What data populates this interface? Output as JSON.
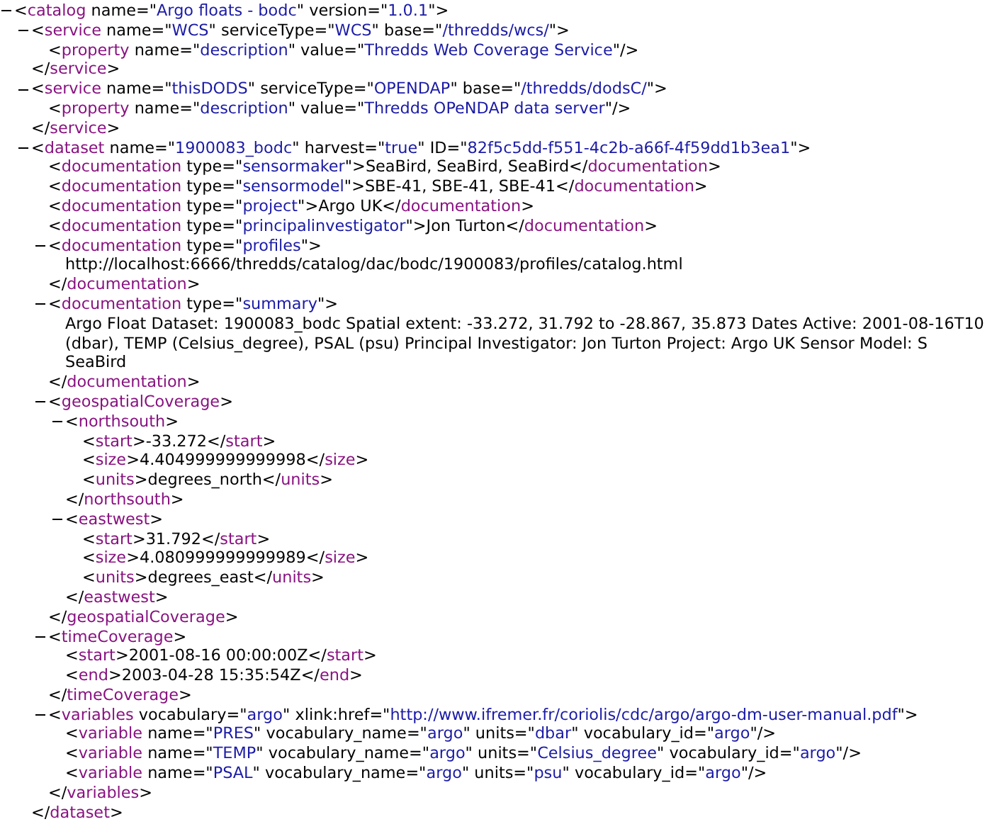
{
  "document": {
    "kind": "element",
    "expanded": true,
    "open": [
      {
        "kind": "punct",
        "text": "<"
      },
      {
        "kind": "tag",
        "text": "catalog"
      },
      {
        "kind": "attr",
        "text": "name"
      },
      {
        "kind": "punct",
        "text": "=\""
      },
      {
        "kind": "value",
        "text": "Argo floats - bodc"
      },
      {
        "kind": "punct",
        "text": "\""
      },
      {
        "kind": "attr",
        "text": "version"
      },
      {
        "kind": "punct",
        "text": "=\""
      },
      {
        "kind": "value",
        "text": "1.0.1"
      },
      {
        "kind": "punct",
        "text": "\">"
      }
    ],
    "children": [
      {
        "kind": "element",
        "expanded": true,
        "open": [
          {
            "kind": "punct",
            "text": "<"
          },
          {
            "kind": "tag",
            "text": "service"
          },
          {
            "kind": "attr",
            "text": "name"
          },
          {
            "kind": "punct",
            "text": "=\""
          },
          {
            "kind": "value",
            "text": "WCS"
          },
          {
            "kind": "punct",
            "text": "\""
          },
          {
            "kind": "attr",
            "text": "serviceType"
          },
          {
            "kind": "punct",
            "text": "=\""
          },
          {
            "kind": "value",
            "text": "WCS"
          },
          {
            "kind": "punct",
            "text": "\""
          },
          {
            "kind": "attr",
            "text": "base"
          },
          {
            "kind": "punct",
            "text": "=\""
          },
          {
            "kind": "value",
            "text": "/thredds/wcs/"
          },
          {
            "kind": "punct",
            "text": "\">"
          }
        ],
        "children": [
          {
            "kind": "line",
            "parts": [
              {
                "kind": "punct",
                "text": "<"
              },
              {
                "kind": "tag",
                "text": "property"
              },
              {
                "kind": "attr",
                "text": "name"
              },
              {
                "kind": "punct",
                "text": "=\""
              },
              {
                "kind": "value",
                "text": "description"
              },
              {
                "kind": "punct",
                "text": "\""
              },
              {
                "kind": "attr",
                "text": "value"
              },
              {
                "kind": "punct",
                "text": "=\""
              },
              {
                "kind": "value",
                "text": "Thredds Web Coverage Service"
              },
              {
                "kind": "punct",
                "text": "\"/>"
              }
            ]
          }
        ],
        "close": [
          {
            "kind": "punct",
            "text": "</"
          },
          {
            "kind": "tag",
            "text": "service"
          },
          {
            "kind": "punct",
            "text": ">"
          }
        ]
      },
      {
        "kind": "element",
        "expanded": true,
        "open": [
          {
            "kind": "punct",
            "text": "<"
          },
          {
            "kind": "tag",
            "text": "service"
          },
          {
            "kind": "attr",
            "text": "name"
          },
          {
            "kind": "punct",
            "text": "=\""
          },
          {
            "kind": "value",
            "text": "thisDODS"
          },
          {
            "kind": "punct",
            "text": "\""
          },
          {
            "kind": "attr",
            "text": "serviceType"
          },
          {
            "kind": "punct",
            "text": "=\""
          },
          {
            "kind": "value",
            "text": "OPENDAP"
          },
          {
            "kind": "punct",
            "text": "\""
          },
          {
            "kind": "attr",
            "text": "base"
          },
          {
            "kind": "punct",
            "text": "=\""
          },
          {
            "kind": "value",
            "text": "/thredds/dodsC/"
          },
          {
            "kind": "punct",
            "text": "\">"
          }
        ],
        "children": [
          {
            "kind": "line",
            "parts": [
              {
                "kind": "punct",
                "text": "<"
              },
              {
                "kind": "tag",
                "text": "property"
              },
              {
                "kind": "attr",
                "text": "name"
              },
              {
                "kind": "punct",
                "text": "=\""
              },
              {
                "kind": "value",
                "text": "description"
              },
              {
                "kind": "punct",
                "text": "\""
              },
              {
                "kind": "attr",
                "text": "value"
              },
              {
                "kind": "punct",
                "text": "=\""
              },
              {
                "kind": "value",
                "text": "Thredds OPeNDAP data server"
              },
              {
                "kind": "punct",
                "text": "\"/>"
              }
            ]
          }
        ],
        "close": [
          {
            "kind": "punct",
            "text": "</"
          },
          {
            "kind": "tag",
            "text": "service"
          },
          {
            "kind": "punct",
            "text": ">"
          }
        ]
      },
      {
        "kind": "element",
        "expanded": true,
        "open": [
          {
            "kind": "punct",
            "text": "<"
          },
          {
            "kind": "tag",
            "text": "dataset"
          },
          {
            "kind": "attr",
            "text": "name"
          },
          {
            "kind": "punct",
            "text": "=\""
          },
          {
            "kind": "value",
            "text": "1900083_bodc"
          },
          {
            "kind": "punct",
            "text": "\""
          },
          {
            "kind": "attr",
            "text": "harvest"
          },
          {
            "kind": "punct",
            "text": "=\""
          },
          {
            "kind": "value",
            "text": "true"
          },
          {
            "kind": "punct",
            "text": "\""
          },
          {
            "kind": "attr",
            "text": "ID"
          },
          {
            "kind": "punct",
            "text": "=\""
          },
          {
            "kind": "value",
            "text": "82f5c5dd-f551-4c2b-a66f-4f59dd1b3ea1"
          },
          {
            "kind": "punct",
            "text": "\">"
          }
        ],
        "children": [
          {
            "kind": "line",
            "parts": [
              {
                "kind": "punct",
                "text": "<"
              },
              {
                "kind": "tag",
                "text": "documentation"
              },
              {
                "kind": "attr",
                "text": "type"
              },
              {
                "kind": "punct",
                "text": "=\""
              },
              {
                "kind": "value",
                "text": "sensormaker"
              },
              {
                "kind": "punct",
                "text": "\">"
              },
              {
                "kind": "text",
                "text": "SeaBird, SeaBird, SeaBird"
              },
              {
                "kind": "punct",
                "text": "</"
              },
              {
                "kind": "tag",
                "text": "documentation"
              },
              {
                "kind": "punct",
                "text": ">"
              }
            ]
          },
          {
            "kind": "line",
            "parts": [
              {
                "kind": "punct",
                "text": "<"
              },
              {
                "kind": "tag",
                "text": "documentation"
              },
              {
                "kind": "attr",
                "text": "type"
              },
              {
                "kind": "punct",
                "text": "=\""
              },
              {
                "kind": "value",
                "text": "sensormodel"
              },
              {
                "kind": "punct",
                "text": "\">"
              },
              {
                "kind": "text",
                "text": "SBE-41, SBE-41, SBE-41"
              },
              {
                "kind": "punct",
                "text": "</"
              },
              {
                "kind": "tag",
                "text": "documentation"
              },
              {
                "kind": "punct",
                "text": ">"
              }
            ]
          },
          {
            "kind": "line",
            "parts": [
              {
                "kind": "punct",
                "text": "<"
              },
              {
                "kind": "tag",
                "text": "documentation"
              },
              {
                "kind": "attr",
                "text": "type"
              },
              {
                "kind": "punct",
                "text": "=\""
              },
              {
                "kind": "value",
                "text": "project"
              },
              {
                "kind": "punct",
                "text": "\">"
              },
              {
                "kind": "text",
                "text": "Argo UK"
              },
              {
                "kind": "punct",
                "text": "</"
              },
              {
                "kind": "tag",
                "text": "documentation"
              },
              {
                "kind": "punct",
                "text": ">"
              }
            ]
          },
          {
            "kind": "line",
            "parts": [
              {
                "kind": "punct",
                "text": "<"
              },
              {
                "kind": "tag",
                "text": "documentation"
              },
              {
                "kind": "attr",
                "text": "type"
              },
              {
                "kind": "punct",
                "text": "=\""
              },
              {
                "kind": "value",
                "text": "principalinvestigator"
              },
              {
                "kind": "punct",
                "text": "\">"
              },
              {
                "kind": "text",
                "text": "Jon Turton"
              },
              {
                "kind": "punct",
                "text": "</"
              },
              {
                "kind": "tag",
                "text": "documentation"
              },
              {
                "kind": "punct",
                "text": ">"
              }
            ]
          },
          {
            "kind": "element",
            "expanded": true,
            "open": [
              {
                "kind": "punct",
                "text": "<"
              },
              {
                "kind": "tag",
                "text": "documentation"
              },
              {
                "kind": "attr",
                "text": "type"
              },
              {
                "kind": "punct",
                "text": "=\""
              },
              {
                "kind": "value",
                "text": "profiles"
              },
              {
                "kind": "punct",
                "text": "\">"
              }
            ],
            "children": [
              {
                "kind": "line",
                "parts": [
                  {
                    "kind": "text",
                    "text": "http://localhost:6666/thredds/catalog/dac/bodc/1900083/profiles/catalog.html"
                  }
                ]
              }
            ],
            "close": [
              {
                "kind": "punct",
                "text": "</"
              },
              {
                "kind": "tag",
                "text": "documentation"
              },
              {
                "kind": "punct",
                "text": ">"
              }
            ]
          },
          {
            "kind": "element",
            "expanded": true,
            "open": [
              {
                "kind": "punct",
                "text": "<"
              },
              {
                "kind": "tag",
                "text": "documentation"
              },
              {
                "kind": "attr",
                "text": "type"
              },
              {
                "kind": "punct",
                "text": "=\""
              },
              {
                "kind": "value",
                "text": "summary"
              },
              {
                "kind": "punct",
                "text": "\">"
              }
            ],
            "children": [
              {
                "kind": "line",
                "parts": [
                  {
                    "kind": "text",
                    "text": "Argo Float Dataset: 1900083_bodc Spatial extent: -33.272, 31.792 to -28.867, 35.873 Dates Active: 2001-08-16T10"
                  }
                ]
              },
              {
                "kind": "line",
                "parts": [
                  {
                    "kind": "text",
                    "text": "(dbar), TEMP (Celsius_degree), PSAL (psu) Principal Investigator: Jon Turton Project: Argo UK Sensor Model: S"
                  }
                ]
              },
              {
                "kind": "line",
                "parts": [
                  {
                    "kind": "text",
                    "text": "SeaBird"
                  }
                ]
              }
            ],
            "close": [
              {
                "kind": "punct",
                "text": "</"
              },
              {
                "kind": "tag",
                "text": "documentation"
              },
              {
                "kind": "punct",
                "text": ">"
              }
            ]
          },
          {
            "kind": "element",
            "expanded": true,
            "open": [
              {
                "kind": "punct",
                "text": "<"
              },
              {
                "kind": "tag",
                "text": "geospatialCoverage"
              },
              {
                "kind": "punct",
                "text": ">"
              }
            ],
            "children": [
              {
                "kind": "element",
                "expanded": true,
                "open": [
                  {
                    "kind": "punct",
                    "text": "<"
                  },
                  {
                    "kind": "tag",
                    "text": "northsouth"
                  },
                  {
                    "kind": "punct",
                    "text": ">"
                  }
                ],
                "children": [
                  {
                    "kind": "line",
                    "parts": [
                      {
                        "kind": "punct",
                        "text": "<"
                      },
                      {
                        "kind": "tag",
                        "text": "start"
                      },
                      {
                        "kind": "punct",
                        "text": ">"
                      },
                      {
                        "kind": "text",
                        "text": "-33.272"
                      },
                      {
                        "kind": "punct",
                        "text": "</"
                      },
                      {
                        "kind": "tag",
                        "text": "start"
                      },
                      {
                        "kind": "punct",
                        "text": ">"
                      }
                    ]
                  },
                  {
                    "kind": "line",
                    "parts": [
                      {
                        "kind": "punct",
                        "text": "<"
                      },
                      {
                        "kind": "tag",
                        "text": "size"
                      },
                      {
                        "kind": "punct",
                        "text": ">"
                      },
                      {
                        "kind": "text",
                        "text": "4.404999999999998"
                      },
                      {
                        "kind": "punct",
                        "text": "</"
                      },
                      {
                        "kind": "tag",
                        "text": "size"
                      },
                      {
                        "kind": "punct",
                        "text": ">"
                      }
                    ]
                  },
                  {
                    "kind": "line",
                    "parts": [
                      {
                        "kind": "punct",
                        "text": "<"
                      },
                      {
                        "kind": "tag",
                        "text": "units"
                      },
                      {
                        "kind": "punct",
                        "text": ">"
                      },
                      {
                        "kind": "text",
                        "text": "degrees_north"
                      },
                      {
                        "kind": "punct",
                        "text": "</"
                      },
                      {
                        "kind": "tag",
                        "text": "units"
                      },
                      {
                        "kind": "punct",
                        "text": ">"
                      }
                    ]
                  }
                ],
                "close": [
                  {
                    "kind": "punct",
                    "text": "</"
                  },
                  {
                    "kind": "tag",
                    "text": "northsouth"
                  },
                  {
                    "kind": "punct",
                    "text": ">"
                  }
                ]
              },
              {
                "kind": "element",
                "expanded": true,
                "open": [
                  {
                    "kind": "punct",
                    "text": "<"
                  },
                  {
                    "kind": "tag",
                    "text": "eastwest"
                  },
                  {
                    "kind": "punct",
                    "text": ">"
                  }
                ],
                "children": [
                  {
                    "kind": "line",
                    "parts": [
                      {
                        "kind": "punct",
                        "text": "<"
                      },
                      {
                        "kind": "tag",
                        "text": "start"
                      },
                      {
                        "kind": "punct",
                        "text": ">"
                      },
                      {
                        "kind": "text",
                        "text": "31.792"
                      },
                      {
                        "kind": "punct",
                        "text": "</"
                      },
                      {
                        "kind": "tag",
                        "text": "start"
                      },
                      {
                        "kind": "punct",
                        "text": ">"
                      }
                    ]
                  },
                  {
                    "kind": "line",
                    "parts": [
                      {
                        "kind": "punct",
                        "text": "<"
                      },
                      {
                        "kind": "tag",
                        "text": "size"
                      },
                      {
                        "kind": "punct",
                        "text": ">"
                      },
                      {
                        "kind": "text",
                        "text": "4.080999999999989"
                      },
                      {
                        "kind": "punct",
                        "text": "</"
                      },
                      {
                        "kind": "tag",
                        "text": "size"
                      },
                      {
                        "kind": "punct",
                        "text": ">"
                      }
                    ]
                  },
                  {
                    "kind": "line",
                    "parts": [
                      {
                        "kind": "punct",
                        "text": "<"
                      },
                      {
                        "kind": "tag",
                        "text": "units"
                      },
                      {
                        "kind": "punct",
                        "text": ">"
                      },
                      {
                        "kind": "text",
                        "text": "degrees_east"
                      },
                      {
                        "kind": "punct",
                        "text": "</"
                      },
                      {
                        "kind": "tag",
                        "text": "units"
                      },
                      {
                        "kind": "punct",
                        "text": ">"
                      }
                    ]
                  }
                ],
                "close": [
                  {
                    "kind": "punct",
                    "text": "</"
                  },
                  {
                    "kind": "tag",
                    "text": "eastwest"
                  },
                  {
                    "kind": "punct",
                    "text": ">"
                  }
                ]
              }
            ],
            "close": [
              {
                "kind": "punct",
                "text": "</"
              },
              {
                "kind": "tag",
                "text": "geospatialCoverage"
              },
              {
                "kind": "punct",
                "text": ">"
              }
            ]
          },
          {
            "kind": "element",
            "expanded": true,
            "open": [
              {
                "kind": "punct",
                "text": "<"
              },
              {
                "kind": "tag",
                "text": "timeCoverage"
              },
              {
                "kind": "punct",
                "text": ">"
              }
            ],
            "children": [
              {
                "kind": "line",
                "parts": [
                  {
                    "kind": "punct",
                    "text": "<"
                  },
                  {
                    "kind": "tag",
                    "text": "start"
                  },
                  {
                    "kind": "punct",
                    "text": ">"
                  },
                  {
                    "kind": "text",
                    "text": "2001-08-16 00:00:00Z"
                  },
                  {
                    "kind": "punct",
                    "text": "</"
                  },
                  {
                    "kind": "tag",
                    "text": "start"
                  },
                  {
                    "kind": "punct",
                    "text": ">"
                  }
                ]
              },
              {
                "kind": "line",
                "parts": [
                  {
                    "kind": "punct",
                    "text": "<"
                  },
                  {
                    "kind": "tag",
                    "text": "end"
                  },
                  {
                    "kind": "punct",
                    "text": ">"
                  },
                  {
                    "kind": "text",
                    "text": "2003-04-28 15:35:54Z"
                  },
                  {
                    "kind": "punct",
                    "text": "</"
                  },
                  {
                    "kind": "tag",
                    "text": "end"
                  },
                  {
                    "kind": "punct",
                    "text": ">"
                  }
                ]
              }
            ],
            "close": [
              {
                "kind": "punct",
                "text": "</"
              },
              {
                "kind": "tag",
                "text": "timeCoverage"
              },
              {
                "kind": "punct",
                "text": ">"
              }
            ]
          },
          {
            "kind": "element",
            "expanded": true,
            "open": [
              {
                "kind": "punct",
                "text": "<"
              },
              {
                "kind": "tag",
                "text": "variables"
              },
              {
                "kind": "attr",
                "text": "vocabulary"
              },
              {
                "kind": "punct",
                "text": "=\""
              },
              {
                "kind": "value",
                "text": "argo"
              },
              {
                "kind": "punct",
                "text": "\""
              },
              {
                "kind": "attr",
                "text": "xlink:href"
              },
              {
                "kind": "punct",
                "text": "=\""
              },
              {
                "kind": "value",
                "text": "http://www.ifremer.fr/coriolis/cdc/argo/argo-dm-user-manual.pdf"
              },
              {
                "kind": "punct",
                "text": "\">"
              }
            ],
            "children": [
              {
                "kind": "line",
                "parts": [
                  {
                    "kind": "punct",
                    "text": "<"
                  },
                  {
                    "kind": "tag",
                    "text": "variable"
                  },
                  {
                    "kind": "attr",
                    "text": "name"
                  },
                  {
                    "kind": "punct",
                    "text": "=\""
                  },
                  {
                    "kind": "value",
                    "text": "PRES"
                  },
                  {
                    "kind": "punct",
                    "text": "\""
                  },
                  {
                    "kind": "attr",
                    "text": "vocabulary_name"
                  },
                  {
                    "kind": "punct",
                    "text": "=\""
                  },
                  {
                    "kind": "value",
                    "text": "argo"
                  },
                  {
                    "kind": "punct",
                    "text": "\""
                  },
                  {
                    "kind": "attr",
                    "text": "units"
                  },
                  {
                    "kind": "punct",
                    "text": "=\""
                  },
                  {
                    "kind": "value",
                    "text": "dbar"
                  },
                  {
                    "kind": "punct",
                    "text": "\""
                  },
                  {
                    "kind": "attr",
                    "text": "vocabulary_id"
                  },
                  {
                    "kind": "punct",
                    "text": "=\""
                  },
                  {
                    "kind": "value",
                    "text": "argo"
                  },
                  {
                    "kind": "punct",
                    "text": "\"/>"
                  }
                ]
              },
              {
                "kind": "line",
                "parts": [
                  {
                    "kind": "punct",
                    "text": "<"
                  },
                  {
                    "kind": "tag",
                    "text": "variable"
                  },
                  {
                    "kind": "attr",
                    "text": "name"
                  },
                  {
                    "kind": "punct",
                    "text": "=\""
                  },
                  {
                    "kind": "value",
                    "text": "TEMP"
                  },
                  {
                    "kind": "punct",
                    "text": "\""
                  },
                  {
                    "kind": "attr",
                    "text": "vocabulary_name"
                  },
                  {
                    "kind": "punct",
                    "text": "=\""
                  },
                  {
                    "kind": "value",
                    "text": "argo"
                  },
                  {
                    "kind": "punct",
                    "text": "\""
                  },
                  {
                    "kind": "attr",
                    "text": "units"
                  },
                  {
                    "kind": "punct",
                    "text": "=\""
                  },
                  {
                    "kind": "value",
                    "text": "Celsius_degree"
                  },
                  {
                    "kind": "punct",
                    "text": "\""
                  },
                  {
                    "kind": "attr",
                    "text": "vocabulary_id"
                  },
                  {
                    "kind": "punct",
                    "text": "=\""
                  },
                  {
                    "kind": "value",
                    "text": "argo"
                  },
                  {
                    "kind": "punct",
                    "text": "\"/>"
                  }
                ]
              },
              {
                "kind": "line",
                "parts": [
                  {
                    "kind": "punct",
                    "text": "<"
                  },
                  {
                    "kind": "tag",
                    "text": "variable"
                  },
                  {
                    "kind": "attr",
                    "text": "name"
                  },
                  {
                    "kind": "punct",
                    "text": "=\""
                  },
                  {
                    "kind": "value",
                    "text": "PSAL"
                  },
                  {
                    "kind": "punct",
                    "text": "\""
                  },
                  {
                    "kind": "attr",
                    "text": "vocabulary_name"
                  },
                  {
                    "kind": "punct",
                    "text": "=\""
                  },
                  {
                    "kind": "value",
                    "text": "argo"
                  },
                  {
                    "kind": "punct",
                    "text": "\""
                  },
                  {
                    "kind": "attr",
                    "text": "units"
                  },
                  {
                    "kind": "punct",
                    "text": "=\""
                  },
                  {
                    "kind": "value",
                    "text": "psu"
                  },
                  {
                    "kind": "punct",
                    "text": "\""
                  },
                  {
                    "kind": "attr",
                    "text": "vocabulary_id"
                  },
                  {
                    "kind": "punct",
                    "text": "=\""
                  },
                  {
                    "kind": "value",
                    "text": "argo"
                  },
                  {
                    "kind": "punct",
                    "text": "\"/>"
                  }
                ]
              }
            ],
            "close": [
              {
                "kind": "punct",
                "text": "</"
              },
              {
                "kind": "tag",
                "text": "variables"
              },
              {
                "kind": "punct",
                "text": ">"
              }
            ]
          }
        ],
        "close": [
          {
            "kind": "punct",
            "text": "</"
          },
          {
            "kind": "tag",
            "text": "dataset"
          },
          {
            "kind": "punct",
            "text": ">"
          }
        ]
      }
    ]
  }
}
